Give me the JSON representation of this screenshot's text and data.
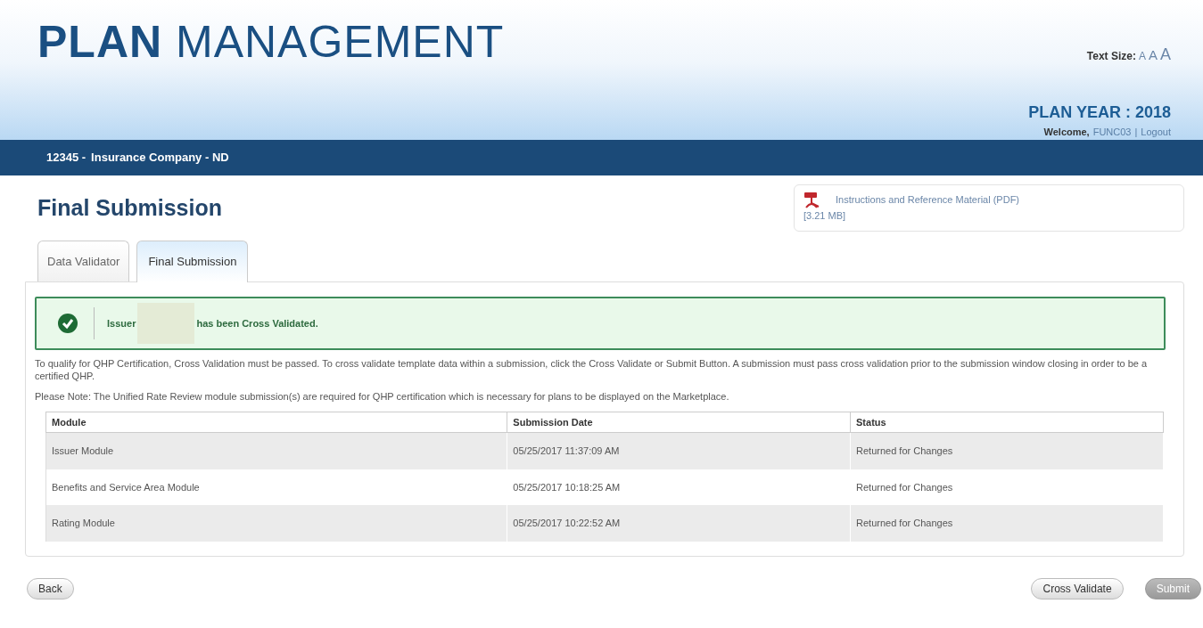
{
  "header": {
    "title_bold": "PLAN",
    "title_rest": "MANAGEMENT",
    "text_size_label": "Text Size:",
    "text_size_options": [
      "A",
      "A",
      "A"
    ],
    "plan_year": "PLAN YEAR : 2018",
    "welcome": "Welcome,",
    "user": "FUNC03",
    "separator": "|",
    "logout": "Logout"
  },
  "org_bar": {
    "id": "12345 -",
    "name": "Insurance Company - ND"
  },
  "page_title": "Final Submission",
  "reference_link": {
    "text": "Instructions and Reference Material (PDF)",
    "size": "[3.21 MB]"
  },
  "tabs": [
    {
      "label": "Data Validator",
      "selected": false
    },
    {
      "label": "Final Submission",
      "selected": true
    }
  ],
  "alert": {
    "kind": "success",
    "before": "Issuer",
    "redacted": true,
    "after": "has been Cross Validated."
  },
  "paragraphs": [
    "To qualify for QHP Certification, Cross Validation must be passed. To cross validate template data within a submission, click the Cross Validate or Submit Button. A submission must pass cross validation prior to the submission window closing in order to be a certified QHP.",
    "Please Note: The Unified Rate Review module submission(s) are required for QHP certification which is necessary for plans to be displayed on the Marketplace."
  ],
  "table": {
    "columns": [
      "Module",
      "Submission Date",
      "Status"
    ],
    "rows": [
      [
        "Issuer Module",
        "05/25/2017 11:37:09 AM",
        "Returned for Changes"
      ],
      [
        "Benefits and Service Area Module",
        "05/25/2017 10:18:25 AM",
        "Returned for Changes"
      ],
      [
        "Rating Module",
        "05/25/2017 10:22:52 AM",
        "Returned for Changes"
      ]
    ]
  },
  "buttons": {
    "back": {
      "label": "Back",
      "disabled": false
    },
    "cross_validate": {
      "label": "Cross Validate",
      "disabled": false
    },
    "submit": {
      "label": "Submit",
      "disabled": true
    }
  }
}
